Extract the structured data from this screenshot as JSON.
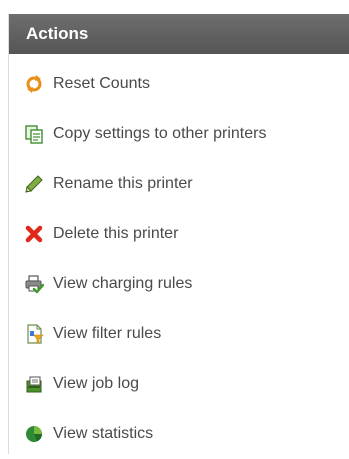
{
  "panel": {
    "title": "Actions",
    "items": [
      {
        "label": "Reset Counts",
        "icon": "reset-icon"
      },
      {
        "label": "Copy settings to other printers",
        "icon": "copy-icon"
      },
      {
        "label": "Rename this printer",
        "icon": "pencil-icon"
      },
      {
        "label": "Delete this printer",
        "icon": "delete-x-icon"
      },
      {
        "label": "View charging rules",
        "icon": "printer-check-icon"
      },
      {
        "label": "View filter rules",
        "icon": "filter-document-icon"
      },
      {
        "label": "View job log",
        "icon": "job-log-icon"
      },
      {
        "label": "View statistics",
        "icon": "pie-chart-icon"
      }
    ]
  },
  "colors": {
    "header_bg": "#5e5e5e",
    "header_text": "#ffffff",
    "label_text": "#4a4a4a"
  }
}
